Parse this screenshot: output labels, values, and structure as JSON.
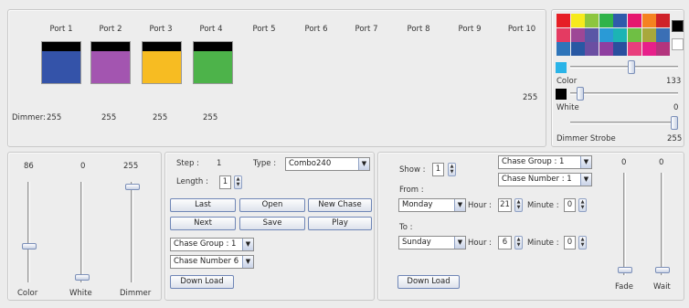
{
  "ports": {
    "labels": [
      "Port 1",
      "Port 2",
      "Port 3",
      "Port 4",
      "Port 5",
      "Port 6",
      "Port 7",
      "Port 8",
      "Port 9",
      "Port 10"
    ],
    "swatch_colors": [
      "#3453a9",
      "#a355b0",
      "#f7bc22",
      "#4db34a"
    ],
    "dimmer_label": "Dimmer:",
    "dimmer_values": [
      "255",
      "255",
      "255",
      "255"
    ],
    "right_value": "255"
  },
  "palette": {
    "colors": [
      [
        "#e61e25",
        "#f6ea1d",
        "#8dc63f",
        "#30b34a",
        "#2f5bab",
        "#e6176f",
        "#f58220",
        "#cf2229"
      ],
      [
        "#e43b62",
        "#9e4796",
        "#5a57a6",
        "#2a9ad6",
        "#1cb4b4",
        "#6fbf44",
        "#a8a83c",
        "#3a6fb5"
      ],
      [
        "#2e74b9",
        "#2858a3",
        "#6b4ea2",
        "#8f3fa0",
        "#2a4f9e",
        "#e93f7d",
        "#e7208a",
        "#b3347d"
      ]
    ],
    "black_swatch": "#000000",
    "white_swatch": "#ffffff",
    "selected_color": "#2ab4e8",
    "color_label": "Color",
    "color_value": "133",
    "white_label": "White",
    "white_value": "0",
    "strobe_label": "Dimmer Strobe",
    "strobe_value": "255"
  },
  "sliders": {
    "color": {
      "label": "Color",
      "value": "86"
    },
    "white": {
      "label": "White",
      "value": "0"
    },
    "dimmer": {
      "label": "Dimmer",
      "value": "255"
    }
  },
  "step_panel": {
    "step_label": "Step :",
    "step_value": "1",
    "type_label": "Type :",
    "type_value": "Combo240",
    "length_label": "Length :",
    "length_value": "1",
    "buttons": {
      "last": "Last",
      "open": "Open",
      "new_chase": "New Chase",
      "next": "Next",
      "save": "Save",
      "play": "Play"
    },
    "chase_group": "Chase Group : 1",
    "chase_number": "Chase Number 6",
    "download": "Down Load"
  },
  "schedule": {
    "show_label": "Show :",
    "show_value": "1",
    "chase_group": "Chase Group : 1",
    "chase_number": "Chase Number : 1",
    "from_label": "From :",
    "from_day": "Monday",
    "from_hour_label": "Hour :",
    "from_hour": "21",
    "from_minute_label": "Minute :",
    "from_minute": "0",
    "to_label": "To :",
    "to_day": "Sunday",
    "to_hour_label": "Hour :",
    "to_hour": "6",
    "to_minute_label": "Minute :",
    "to_minute": "0",
    "download": "Down Load"
  },
  "fade_wait": {
    "fade": {
      "label": "Fade",
      "value": "0"
    },
    "wait": {
      "label": "Wait",
      "value": "0"
    }
  }
}
